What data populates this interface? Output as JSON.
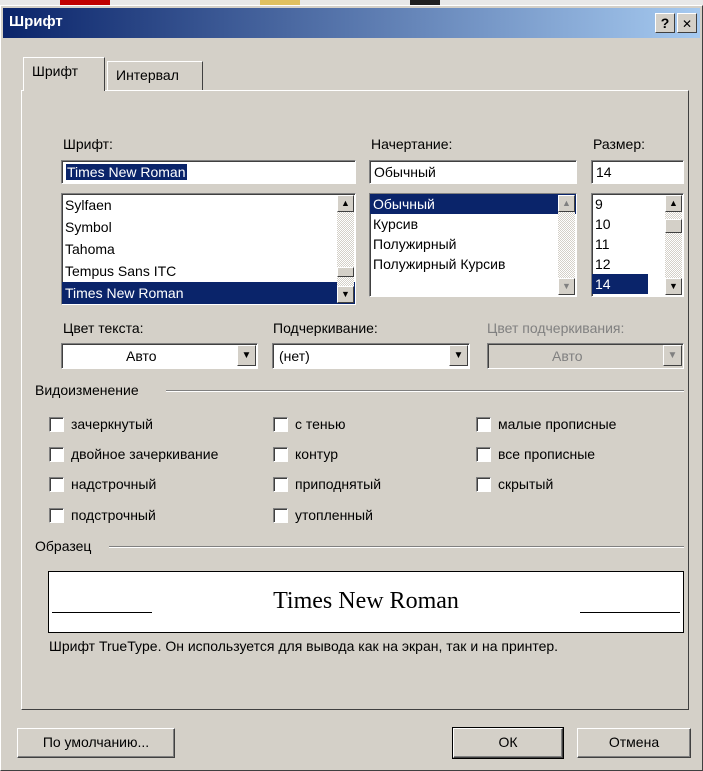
{
  "window": {
    "title": "Шрифт",
    "help_button": "?",
    "close_button": "✕"
  },
  "tabs": [
    {
      "label": "Шрифт",
      "active": true
    },
    {
      "label": "Интервал",
      "active": false
    }
  ],
  "font": {
    "label": "Шрифт:",
    "value": "Times New Roman",
    "list": [
      "Sylfaen",
      "Symbol",
      "Tahoma",
      "Tempus Sans ITC",
      "Times New Roman"
    ],
    "selected_index": 4
  },
  "style": {
    "label": "Начертание:",
    "value": "Обычный",
    "list": [
      "Обычный",
      "Курсив",
      "Полужирный",
      "Полужирный Курсив"
    ],
    "selected_index": 0
  },
  "size": {
    "label": "Размер:",
    "value": "14",
    "list": [
      "9",
      "10",
      "11",
      "12",
      "14"
    ],
    "selected_index": 4
  },
  "text_color": {
    "label": "Цвет текста:",
    "value": "Авто"
  },
  "underline": {
    "label": "Подчеркивание:",
    "value": "(нет)"
  },
  "underline_color": {
    "label": "Цвет подчеркивания:",
    "value": "Авто",
    "disabled": true
  },
  "effects": {
    "label": "Видоизменение",
    "items": [
      "зачеркнутый",
      "двойное зачеркивание",
      "надстрочный",
      "подстрочный",
      "с тенью",
      "контур",
      "приподнятый",
      "утопленный",
      "малые прописные",
      "все прописные",
      "скрытый"
    ]
  },
  "sample": {
    "label": "Образец",
    "text": "Times New Roman",
    "description": "Шрифт TrueType. Он используется для вывода как на экран, так и на принтер."
  },
  "buttons": {
    "default": "По умолчанию...",
    "ok": "ОК",
    "cancel": "Отмена"
  },
  "colors": {
    "title_start": "#0a246a",
    "title_end": "#a6caf0",
    "face": "#d4d0c8",
    "selection": "#0a246a"
  }
}
